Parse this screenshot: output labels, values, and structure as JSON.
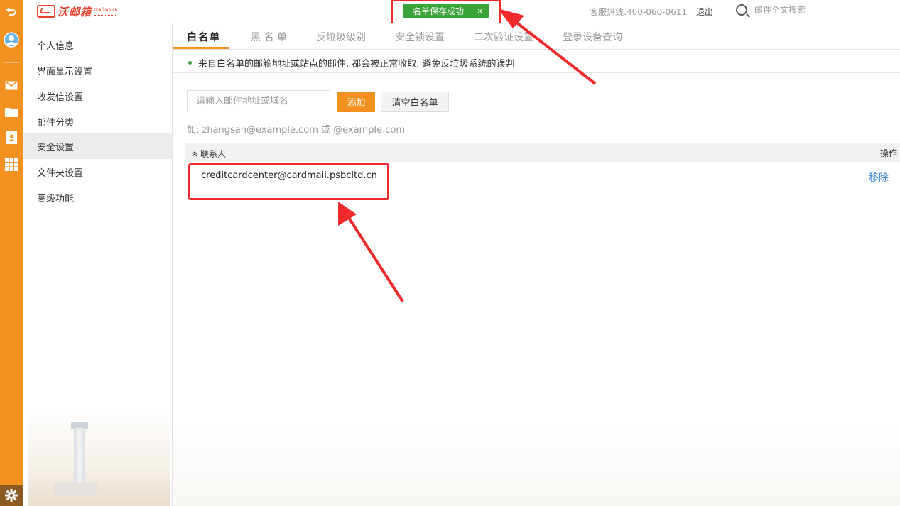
{
  "header": {
    "logo_text": "沃邮箱",
    "logo_sub": "mail.wo.cn",
    "toast": {
      "label": "名单保存成功",
      "close": "×"
    },
    "hotline": "客服热线:400-060-0611",
    "logout": "退出",
    "search_placeholder": "邮件全文搜索"
  },
  "rail": {
    "icons": [
      "back-icon",
      "avatar-icon",
      "mail-icon",
      "folder-icon",
      "contacts-icon",
      "apps-icon",
      "settings-icon"
    ]
  },
  "sidebar": {
    "items": [
      {
        "label": "个人信息",
        "active": false
      },
      {
        "label": "界面显示设置",
        "active": false
      },
      {
        "label": "收发信设置",
        "active": false
      },
      {
        "label": "邮件分类",
        "active": false
      },
      {
        "label": "安全设置",
        "active": true
      },
      {
        "label": "文件夹设置",
        "active": false
      },
      {
        "label": "高级功能",
        "active": false
      }
    ]
  },
  "main": {
    "tabs": [
      {
        "label": "白名单",
        "active": true
      },
      {
        "label": "黑 名 单",
        "active": false
      },
      {
        "label": "反垃圾级别",
        "active": false
      },
      {
        "label": "安全锁设置",
        "active": false
      },
      {
        "label": "二次验证设置",
        "active": false
      },
      {
        "label": "登录设备查询",
        "active": false
      }
    ],
    "notice": "来自白名单的邮箱地址或站点的邮件, 都会被正常收取, 避免反垃圾系统的误判",
    "input_placeholder": "请输入邮件地址或域名",
    "input_value": "",
    "add_label": "添加",
    "clear_label": "清空白名单",
    "hint": "如: zhangsan@example.com 或 @example.com",
    "table": {
      "col_contact": "联系人",
      "col_action": "操作",
      "rows": [
        {
          "email": "creditcardcenter@cardmail.psbcltd.cn",
          "action": "移除"
        }
      ]
    }
  },
  "colors": {
    "accent": "#f29020",
    "success": "#3aa43a",
    "annotation": "#f02a2a",
    "link": "#3a88d8"
  }
}
